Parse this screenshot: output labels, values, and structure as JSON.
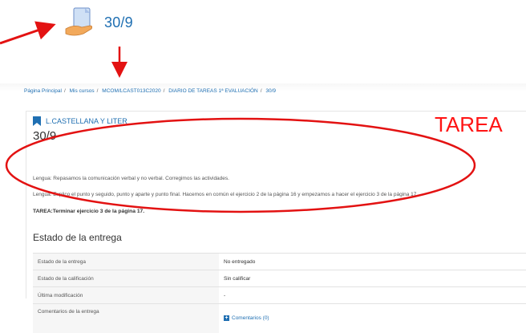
{
  "top": {
    "title": "30/9",
    "icon": "assignment-hand-icon"
  },
  "breadcrumb": [
    "Página Principal",
    "Mis cursos",
    "MCOM/LCAST013C2020",
    "DIARIO DE TAREAS 1ª EVALUACIÓN",
    "30/9"
  ],
  "course": {
    "label": "L.CASTELLANA Y LITER"
  },
  "assignment": {
    "title": "30/9",
    "annotation": "TAREA",
    "lines": [
      "Lengua: Repasamos la comunicación verbal y no verbal. Corregimos las actividades.",
      "Lengua: Explico el punto y seguido, punto y aparte y punto final. Hacemos en común el ejercicio 2 de la página 16 y empezamos a hacer el ejercicio 3 de la página 17."
    ],
    "task": "TAREA:Terminar ejercicio 3 de la página 17."
  },
  "status": {
    "heading": "Estado de la entrega",
    "rows": [
      {
        "label": "Estado de la entrega",
        "value": "No entregado"
      },
      {
        "label": "Estado de la calificación",
        "value": "Sin calificar"
      },
      {
        "label": "Última modificación",
        "value": "-"
      },
      {
        "label": "Comentarios de la entrega",
        "value": "Comentarios (0)"
      }
    ]
  },
  "colors": {
    "link": "#1f6fb2",
    "annotation": "#ff1414"
  }
}
